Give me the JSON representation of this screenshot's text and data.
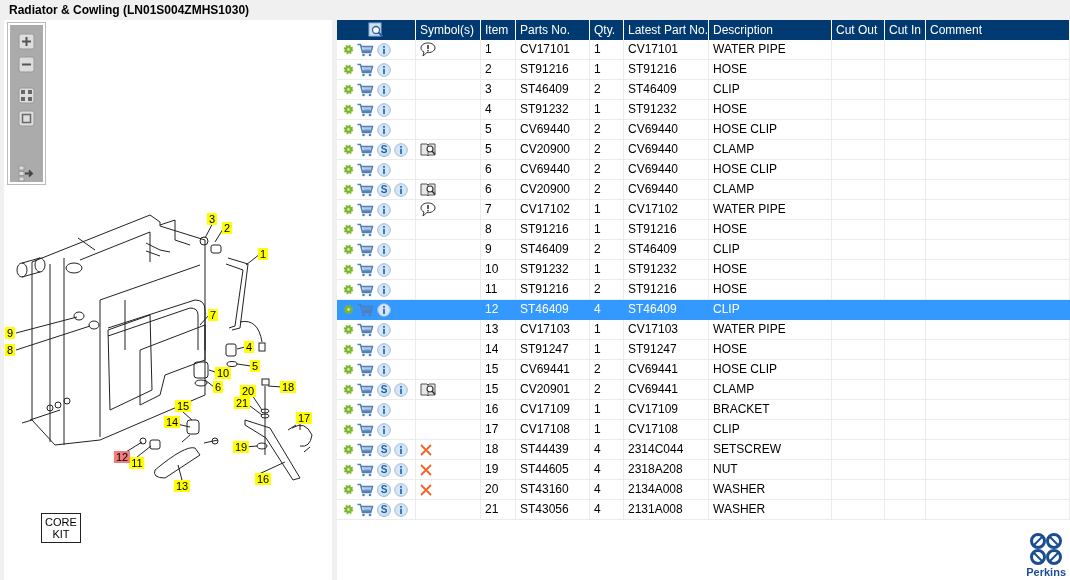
{
  "title": "Radiator & Cowling (LN01S004ZMHS1030)",
  "diagram": {
    "callouts": [
      {
        "label": "1",
        "selected": false
      },
      {
        "label": "2",
        "selected": false
      },
      {
        "label": "3",
        "selected": false
      },
      {
        "label": "4",
        "selected": false
      },
      {
        "label": "5",
        "selected": false
      },
      {
        "label": "6",
        "selected": false
      },
      {
        "label": "7",
        "selected": false
      },
      {
        "label": "8",
        "selected": false
      },
      {
        "label": "9",
        "selected": false
      },
      {
        "label": "10",
        "selected": false
      },
      {
        "label": "11",
        "selected": false
      },
      {
        "label": "12",
        "selected": true
      },
      {
        "label": "13",
        "selected": false
      },
      {
        "label": "14",
        "selected": false
      },
      {
        "label": "15",
        "selected": false
      },
      {
        "label": "16",
        "selected": false
      },
      {
        "label": "17",
        "selected": false
      },
      {
        "label": "18",
        "selected": false
      },
      {
        "label": "19",
        "selected": false
      },
      {
        "label": "20",
        "selected": false
      },
      {
        "label": "21",
        "selected": false
      }
    ],
    "kit_label": "CORE KIT"
  },
  "table": {
    "columns": [
      "Symbol(s)",
      "Item",
      "Parts No.",
      "Qty.",
      "Latest Part No.",
      "Description",
      "Cut Out",
      "Cut In",
      "Comment"
    ],
    "rows": [
      {
        "kind": "note",
        "item": "1",
        "part_no": "CV17101",
        "qty": "1",
        "latest_part_no": "CV17101",
        "description": "WATER PIPE",
        "selected": false
      },
      {
        "kind": "plain",
        "item": "2",
        "part_no": "ST91216",
        "qty": "1",
        "latest_part_no": "ST91216",
        "description": "HOSE",
        "selected": false
      },
      {
        "kind": "plain",
        "item": "3",
        "part_no": "ST46409",
        "qty": "2",
        "latest_part_no": "ST46409",
        "description": "CLIP",
        "selected": false
      },
      {
        "kind": "plain",
        "item": "4",
        "part_no": "ST91232",
        "qty": "1",
        "latest_part_no": "ST91232",
        "description": "HOSE",
        "selected": false
      },
      {
        "kind": "plain",
        "item": "5",
        "part_no": "CV69440",
        "qty": "2",
        "latest_part_no": "CV69440",
        "description": "HOSE CLIP",
        "selected": false
      },
      {
        "badge": "S",
        "kind": "book",
        "item": "5",
        "part_no": "CV20900",
        "qty": "2",
        "latest_part_no": "CV69440",
        "description": "CLAMP",
        "selected": false
      },
      {
        "kind": "plain",
        "item": "6",
        "part_no": "CV69440",
        "qty": "2",
        "latest_part_no": "CV69440",
        "description": "HOSE CLIP",
        "selected": false
      },
      {
        "badge": "S",
        "kind": "book",
        "item": "6",
        "part_no": "CV20900",
        "qty": "2",
        "latest_part_no": "CV69440",
        "description": "CLAMP",
        "selected": false
      },
      {
        "kind": "note",
        "item": "7",
        "part_no": "CV17102",
        "qty": "1",
        "latest_part_no": "CV17102",
        "description": "WATER PIPE",
        "selected": false
      },
      {
        "kind": "plain",
        "item": "8",
        "part_no": "ST91216",
        "qty": "1",
        "latest_part_no": "ST91216",
        "description": "HOSE",
        "selected": false
      },
      {
        "kind": "plain",
        "item": "9",
        "part_no": "ST46409",
        "qty": "2",
        "latest_part_no": "ST46409",
        "description": "CLIP",
        "selected": false
      },
      {
        "kind": "plain",
        "item": "10",
        "part_no": "ST91232",
        "qty": "1",
        "latest_part_no": "ST91232",
        "description": "HOSE",
        "selected": false
      },
      {
        "kind": "plain",
        "item": "11",
        "part_no": "ST91216",
        "qty": "2",
        "latest_part_no": "ST91216",
        "description": "HOSE",
        "selected": false
      },
      {
        "kind": "plain",
        "item": "12",
        "part_no": "ST46409",
        "qty": "4",
        "latest_part_no": "ST46409",
        "description": "CLIP",
        "selected": true
      },
      {
        "kind": "plain",
        "item": "13",
        "part_no": "CV17103",
        "qty": "1",
        "latest_part_no": "CV17103",
        "description": "WATER PIPE",
        "selected": false
      },
      {
        "kind": "plain",
        "item": "14",
        "part_no": "ST91247",
        "qty": "1",
        "latest_part_no": "ST91247",
        "description": "HOSE",
        "selected": false
      },
      {
        "kind": "plain",
        "item": "15",
        "part_no": "CV69441",
        "qty": "2",
        "latest_part_no": "CV69441",
        "description": "HOSE CLIP",
        "selected": false
      },
      {
        "badge": "S",
        "kind": "book",
        "item": "15",
        "part_no": "CV20901",
        "qty": "2",
        "latest_part_no": "CV69441",
        "description": "CLAMP",
        "selected": false
      },
      {
        "kind": "plain",
        "item": "16",
        "part_no": "CV17109",
        "qty": "1",
        "latest_part_no": "CV17109",
        "description": "BRACKET",
        "selected": false
      },
      {
        "kind": "plain",
        "item": "17",
        "part_no": "CV17108",
        "qty": "1",
        "latest_part_no": "CV17108",
        "description": "CLIP",
        "selected": false
      },
      {
        "badge": "S",
        "kind": "cross",
        "item": "18",
        "part_no": "ST44439",
        "qty": "4",
        "latest_part_no": "2314C044",
        "description": "SETSCREW",
        "selected": false
      },
      {
        "badge": "S",
        "kind": "cross",
        "item": "19",
        "part_no": "ST44605",
        "qty": "4",
        "latest_part_no": "2318A208",
        "description": "NUT",
        "selected": false
      },
      {
        "badge": "S",
        "kind": "cross",
        "item": "20",
        "part_no": "ST43160",
        "qty": "4",
        "latest_part_no": "2134A008",
        "description": "WASHER",
        "selected": false
      },
      {
        "badge": "S",
        "kind": "plain",
        "item": "21",
        "part_no": "ST43056",
        "qty": "4",
        "latest_part_no": "2131A008",
        "description": "WASHER",
        "selected": false
      }
    ]
  },
  "brand": "Perkins"
}
